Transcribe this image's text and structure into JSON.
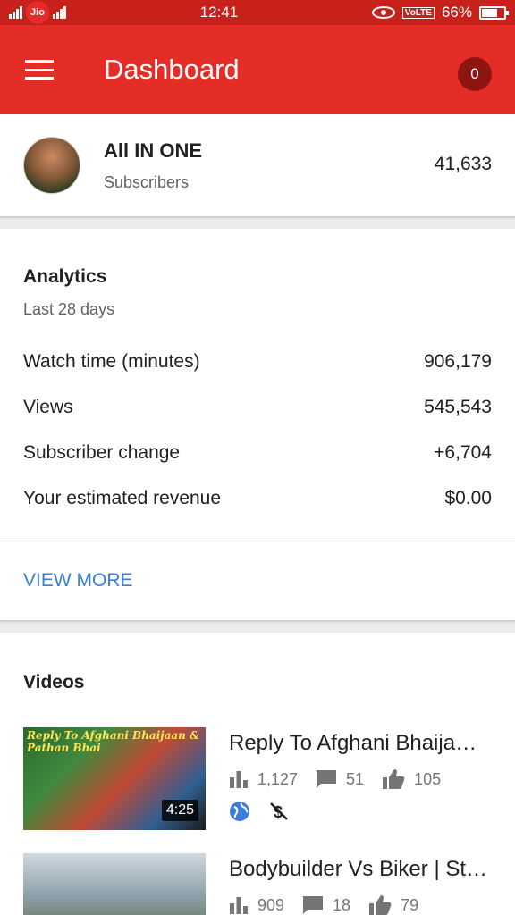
{
  "status_bar": {
    "carrier": "Jio",
    "time": "12:41",
    "volte": "VoLTE",
    "battery": "66%"
  },
  "app_bar": {
    "title": "Dashboard",
    "notifications": "0"
  },
  "channel": {
    "name": "All IN ONE",
    "subscribers_label": "Subscribers",
    "subscribers": "41,633"
  },
  "analytics": {
    "title": "Analytics",
    "period": "Last 28 days",
    "rows": [
      {
        "label": "Watch time (minutes)",
        "value": "906,179"
      },
      {
        "label": "Views",
        "value": "545,543"
      },
      {
        "label": "Subscriber change",
        "value": "+6,704"
      },
      {
        "label": "Your estimated revenue",
        "value": "$0.00"
      }
    ],
    "view_more": "VIEW MORE"
  },
  "videos": {
    "title": "Videos",
    "items": [
      {
        "title": "Reply To Afghani Bhaija…",
        "thumb_text": "Reply To Afghani Bhaijaan & Pathan Bhai",
        "duration": "4:25",
        "views": "1,127",
        "comments": "51",
        "likes": "105"
      },
      {
        "title": "Bodybuilder Vs Biker | St…",
        "views": "909",
        "comments": "18",
        "likes": "79"
      }
    ]
  },
  "colors": {
    "primary": "#e52d27",
    "status_bar": "#c8201a",
    "accent_link": "#3b7ddd"
  }
}
